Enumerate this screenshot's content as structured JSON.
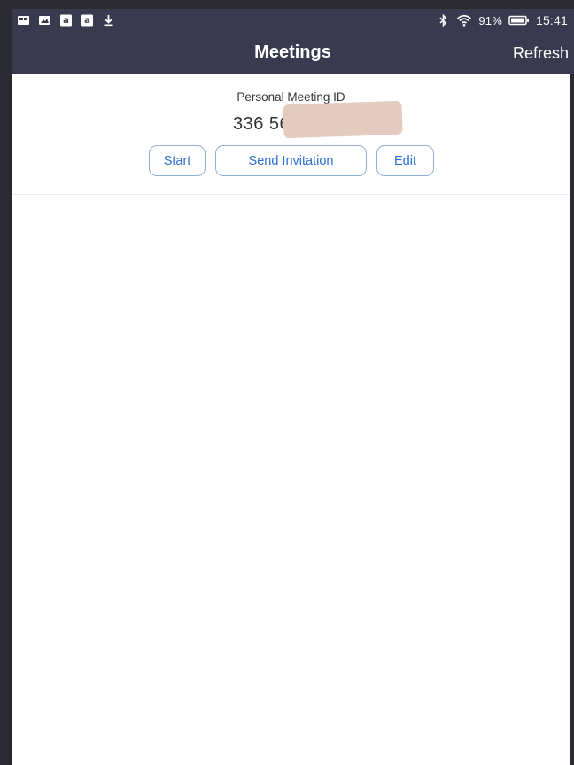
{
  "status_bar": {
    "left_icons": [
      "gallery-icon",
      "image-icon",
      "amazon-icon",
      "amazon-icon",
      "download-icon"
    ],
    "battery_percent": "91%",
    "time": "15:41"
  },
  "header": {
    "title": "Meetings",
    "refresh_label": "Refresh"
  },
  "personal_meeting": {
    "label": "Personal Meeting ID",
    "id_visible": "336 56",
    "buttons": {
      "start": "Start",
      "send_invitation": "Send Invitation",
      "edit": "Edit"
    }
  },
  "colors": {
    "header_bg": "#393a4e",
    "button_text": "#2c6fd1",
    "button_border": "#8fb1d6"
  }
}
